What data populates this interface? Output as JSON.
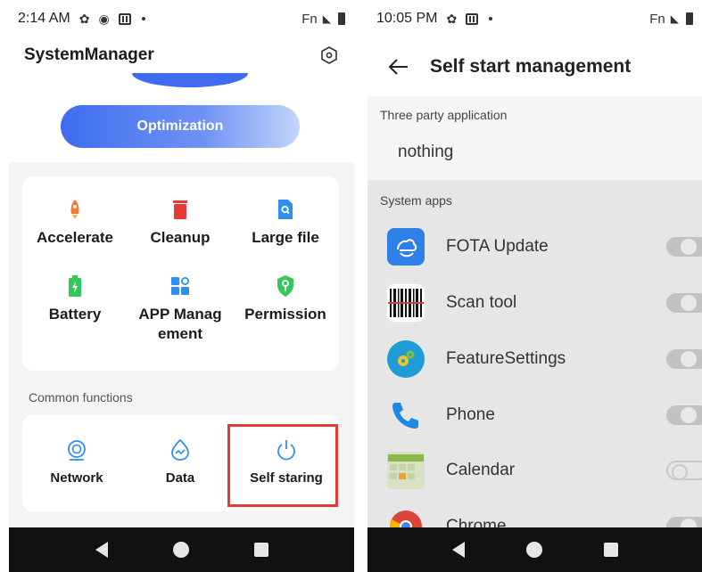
{
  "left": {
    "status": {
      "time": "2:14 AM",
      "right_label": "Fn"
    },
    "title": "SystemManager",
    "optimization_label": "Optimization",
    "tools": [
      {
        "label": "Accelerate",
        "icon": "rocket-icon"
      },
      {
        "label": "Cleanup",
        "icon": "trash-icon"
      },
      {
        "label": "Large file",
        "icon": "file-search-icon"
      },
      {
        "label": "Battery",
        "icon": "battery-icon"
      },
      {
        "label": "APP Manag\nement",
        "icon": "apps-grid-icon"
      },
      {
        "label": "Permission",
        "icon": "shield-key-icon"
      }
    ],
    "common_label": "Common functions",
    "functions": [
      {
        "label": "Network",
        "icon": "network-icon"
      },
      {
        "label": "Data",
        "icon": "data-icon"
      },
      {
        "label": "Self staring",
        "icon": "power-icon"
      }
    ]
  },
  "right": {
    "status": {
      "time": "10:05 PM",
      "right_label": "Fn"
    },
    "title": "Self start management",
    "third_party_label": "Three party application",
    "third_party_value": "nothing",
    "system_label": "System apps",
    "apps": [
      {
        "name": "FOTA Update",
        "enabled": true
      },
      {
        "name": "Scan tool",
        "enabled": true
      },
      {
        "name": "FeatureSettings",
        "enabled": true
      },
      {
        "name": "Phone",
        "enabled": true
      },
      {
        "name": "Calendar",
        "enabled": false
      },
      {
        "name": "Chrome",
        "enabled": true
      }
    ]
  },
  "colors": {
    "accent": "#3f6cef",
    "highlight": "#e53935"
  }
}
